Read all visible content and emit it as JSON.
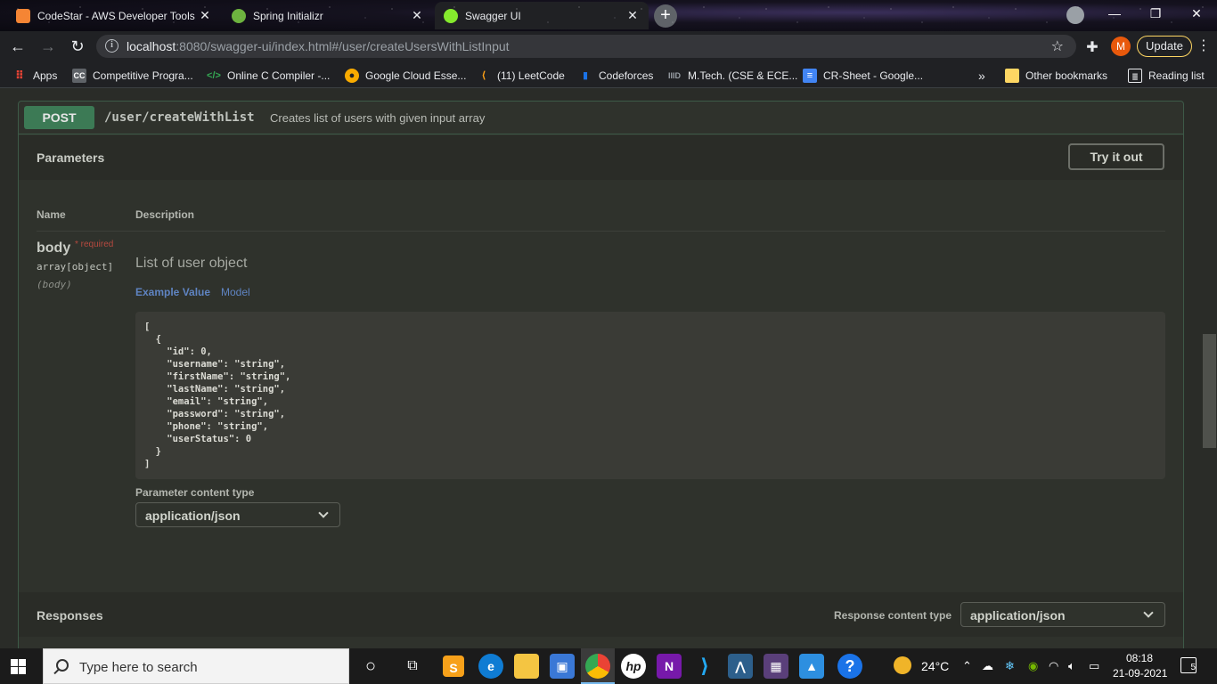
{
  "browser": {
    "tabs": [
      {
        "title": "CodeStar - AWS Developer Tools",
        "favicon_color": "#f58534",
        "active": false
      },
      {
        "title": "Spring Initializr",
        "favicon_color": "#6db33f",
        "active": false
      },
      {
        "title": "Swagger UI",
        "favicon_color": "#85ea2d",
        "active": true
      }
    ],
    "new_tab": "+",
    "url_host": "localhost",
    "url_rest": ":8080/swagger-ui/index.html#/user/createUsersWithListInput",
    "avatar_letter": "M",
    "update_label": "Update",
    "bookmarks": [
      {
        "label": "Apps",
        "icon": "apps-grid-icon",
        "color": "#ea4335"
      },
      {
        "label": "Competitive Progra...",
        "icon": "cc-icon",
        "color": "#5f6368"
      },
      {
        "label": "Online C Compiler -...",
        "icon": "code-icon",
        "color": "#34a853"
      },
      {
        "label": "Google Cloud Esse...",
        "icon": "coursera-icon",
        "color": "#f9ab00"
      },
      {
        "label": "(11) LeetCode",
        "icon": "leetcode-icon",
        "color": "#ffa116"
      },
      {
        "label": "Codeforces",
        "icon": "codeforces-icon",
        "color": "#1a73e8"
      },
      {
        "label": "M.Tech. (CSE & ECE...",
        "icon": "iiitd-icon",
        "color": "#5f6368"
      },
      {
        "label": "CR-Sheet - Google...",
        "icon": "docs-icon",
        "color": "#4285f4"
      }
    ],
    "more_bookmarks": "»",
    "other_bookmarks": "Other bookmarks",
    "reading_list": "Reading list"
  },
  "operation": {
    "method": "POST",
    "path": "/user/createWithList",
    "summary": "Creates list of users with given input array"
  },
  "parameters": {
    "title": "Parameters",
    "try_button": "Try it out",
    "col_name": "Name",
    "col_description": "Description",
    "param": {
      "name": "body",
      "required": "* required",
      "type": "array[object]",
      "in": "(body)",
      "description": "List of user object",
      "tab_example": "Example Value",
      "tab_model": "Model",
      "example": "[\n  {\n    \"id\": 0,\n    \"username\": \"string\",\n    \"firstName\": \"string\",\n    \"lastName\": \"string\",\n    \"email\": \"string\",\n    \"password\": \"string\",\n    \"phone\": \"string\",\n    \"userStatus\": 0\n  }\n]"
    },
    "content_type_label": "Parameter content type",
    "content_type_value": "application/json"
  },
  "responses": {
    "title": "Responses",
    "content_type_label": "Response content type",
    "content_type_value": "application/json"
  },
  "taskbar": {
    "search_placeholder": "Type here to search",
    "temperature": "24°C",
    "time": "08:18",
    "date": "21-09-2021",
    "notifications": "5"
  }
}
